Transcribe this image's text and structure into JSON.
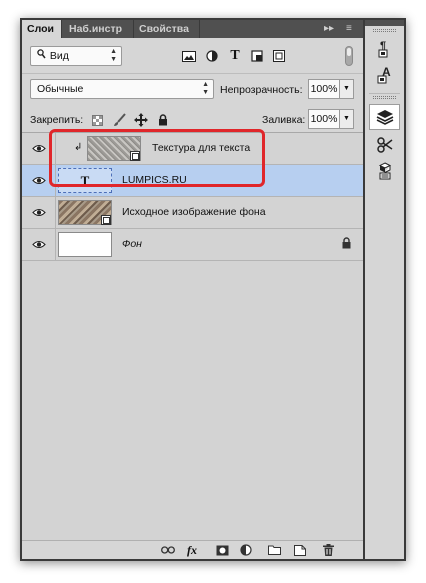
{
  "tabs": [
    {
      "label": "Слои",
      "active": true
    },
    {
      "label": "Наб.инстр",
      "active": false
    },
    {
      "label": "Свойства",
      "active": false
    }
  ],
  "tabbar_controls": {
    "collapse": "▸▸",
    "menu": "≡"
  },
  "filter": {
    "value": "Вид",
    "icons": [
      "image-filter-icon",
      "adjustment-filter-icon",
      "type-filter-icon",
      "shape-filter-icon",
      "smart-object-filter-icon"
    ]
  },
  "blend": {
    "mode": "Обычные",
    "opacity_label": "Непрозрачность:",
    "opacity_value": "100%"
  },
  "lock": {
    "label": "Закрепить:",
    "fill_label": "Заливка:",
    "fill_value": "100%"
  },
  "layers": [
    {
      "name": "Текстура для текста",
      "clipped": true,
      "thumb": "noise",
      "smart": true,
      "selected": false
    },
    {
      "name": "LUMPICS.RU",
      "type": "text",
      "thumb_glyph": "T",
      "selected": true
    },
    {
      "name": "Исходное изображение фона",
      "thumb": "stones",
      "smart": true,
      "selected": false
    },
    {
      "name": "Фон",
      "thumb": "white",
      "locked": true,
      "selected": false
    }
  ],
  "bottom_icons": [
    "link-layers-icon",
    "fx-icon",
    "mask-icon",
    "adjustment-layer-icon",
    "group-folder-icon",
    "new-layer-icon",
    "delete-icon"
  ],
  "bottom_fx_label": "fx",
  "dock_icons": [
    "paragraph-styles-icon",
    "character-styles-icon",
    "layers-panel-icon",
    "tools-icon",
    "3d-icon"
  ],
  "accent_colors": {
    "selection": "#b7cff0",
    "highlight": "#e0262a"
  }
}
